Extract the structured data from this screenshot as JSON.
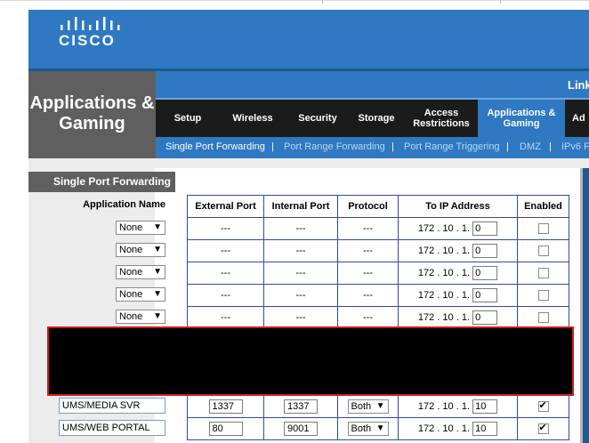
{
  "logo": {
    "wordmark": "CISCO",
    "icon": "cisco-bars-icon"
  },
  "page_title": "Applications & Gaming",
  "brand_link": "Link",
  "tabs": [
    {
      "label": "Setup"
    },
    {
      "label": "Wireless"
    },
    {
      "label": "Security"
    },
    {
      "label": "Storage"
    },
    {
      "label": "Access Restrictions"
    },
    {
      "label": "Applications & Gaming"
    },
    {
      "label": "Ad"
    }
  ],
  "subnav": [
    {
      "label": "Single Port Forwarding"
    },
    {
      "label": "Port Range Forwarding"
    },
    {
      "label": "Port Range Triggering"
    },
    {
      "label": "DMZ"
    },
    {
      "label": "IPv6 F"
    }
  ],
  "subnav_sep": "|",
  "section_title": "Single Port Forwarding",
  "table": {
    "app_name_header": "Application Name",
    "headers": [
      "External Port",
      "Internal Port",
      "Protocol",
      "To IP Address",
      "Enabled"
    ],
    "ip_prefix": "172 . 10 . 1.",
    "rows": [
      {
        "app": "None",
        "ext": "---",
        "int": "---",
        "proto": "---",
        "ip": "0",
        "enabled": false
      },
      {
        "app": "None",
        "ext": "---",
        "int": "---",
        "proto": "---",
        "ip": "0",
        "enabled": false
      },
      {
        "app": "None",
        "ext": "---",
        "int": "---",
        "proto": "---",
        "ip": "0",
        "enabled": false
      },
      {
        "app": "None",
        "ext": "---",
        "int": "---",
        "proto": "---",
        "ip": "0",
        "enabled": false
      },
      {
        "app": "None",
        "ext": "---",
        "int": "---",
        "proto": "---",
        "ip": "0",
        "enabled": false
      }
    ],
    "custom_rows": [
      {
        "app": "UMS/MEDIA SVR",
        "ext": "1337",
        "int": "1337",
        "proto": "Both",
        "ip": "10",
        "enabled": true
      },
      {
        "app": "UMS/WEB PORTAL",
        "ext": "80",
        "int": "9001",
        "proto": "Both",
        "ip": "10",
        "enabled": true
      }
    ]
  },
  "select_arrow": "▼"
}
